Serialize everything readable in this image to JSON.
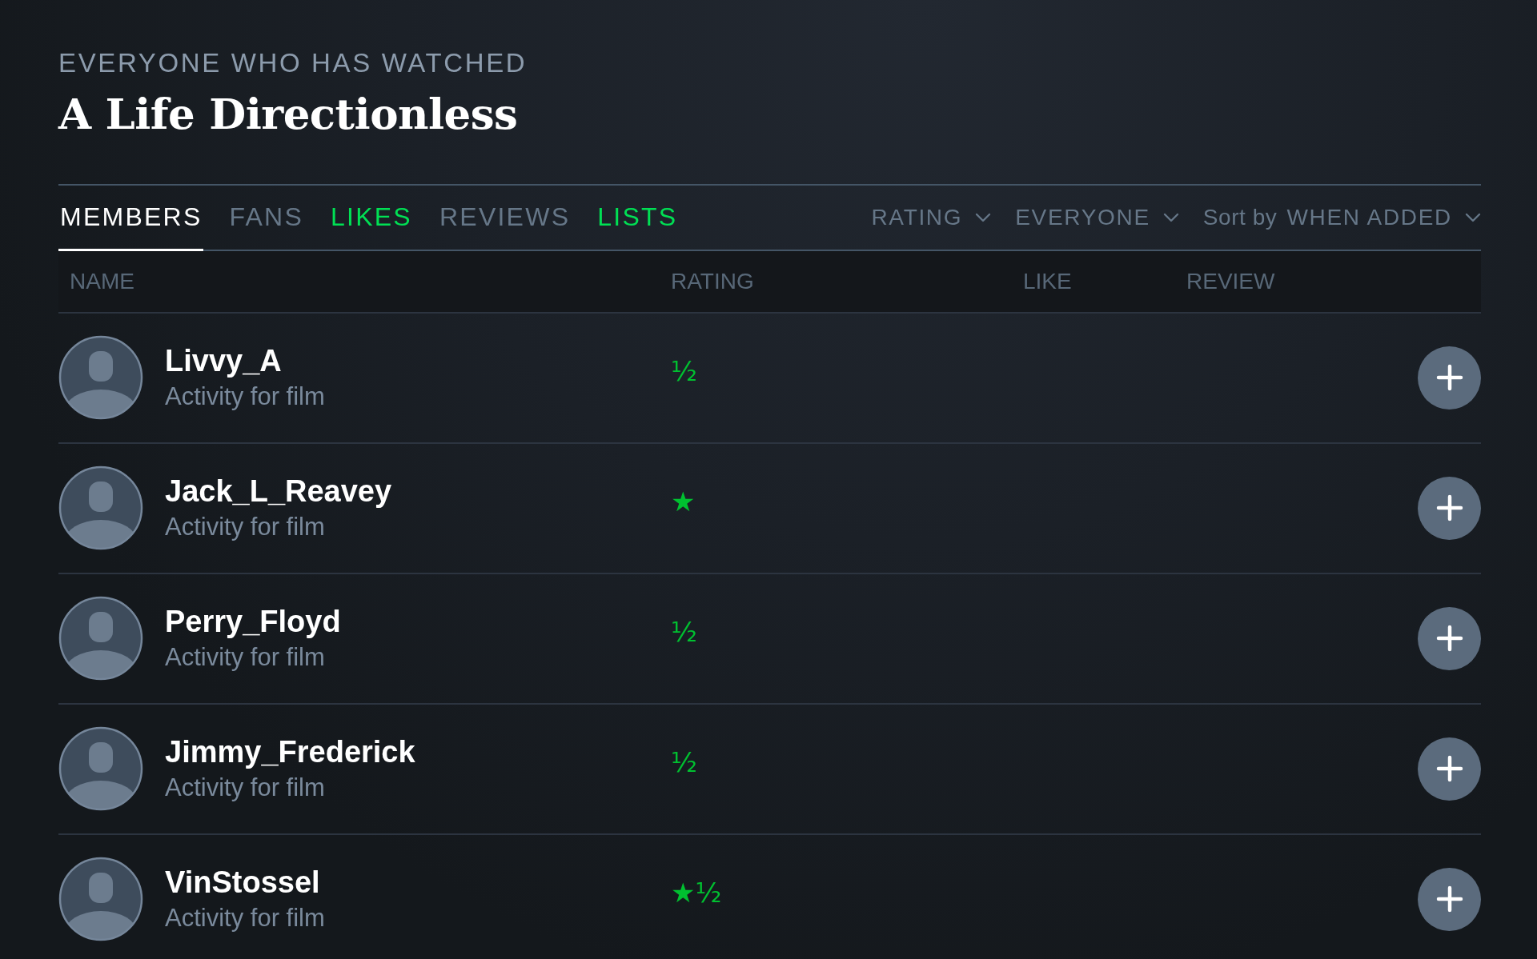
{
  "header": {
    "eyebrow": "EVERYONE WHO HAS WATCHED",
    "title": "A Life Directionless"
  },
  "tabs": [
    {
      "label": "MEMBERS",
      "selected": true,
      "color": "#ffffff"
    },
    {
      "label": "FANS",
      "selected": false,
      "color": "#667788"
    },
    {
      "label": "LIKES",
      "selected": false,
      "color": "#00e054"
    },
    {
      "label": "REVIEWS",
      "selected": false,
      "color": "#667788"
    },
    {
      "label": "LISTS",
      "selected": false,
      "color": "#00e054"
    }
  ],
  "filters": [
    {
      "label": "RATING"
    },
    {
      "label": "EVERYONE"
    },
    {
      "prefix": "Sort by",
      "label": "WHEN ADDED"
    }
  ],
  "table": {
    "columns": [
      "NAME",
      "RATING",
      "LIKE",
      "REVIEW"
    ],
    "rows": [
      {
        "name": "Livvy_A",
        "subtitle": "Activity for film",
        "rating": "½"
      },
      {
        "name": "Jack_L_Reavey",
        "subtitle": "Activity for film",
        "rating": "★"
      },
      {
        "name": "Perry_Floyd",
        "subtitle": "Activity for film",
        "rating": "½"
      },
      {
        "name": "Jimmy_Frederick",
        "subtitle": "Activity for film",
        "rating": "½"
      },
      {
        "name": "VinStossel",
        "subtitle": "Activity for film",
        "rating": "★½"
      }
    ]
  }
}
